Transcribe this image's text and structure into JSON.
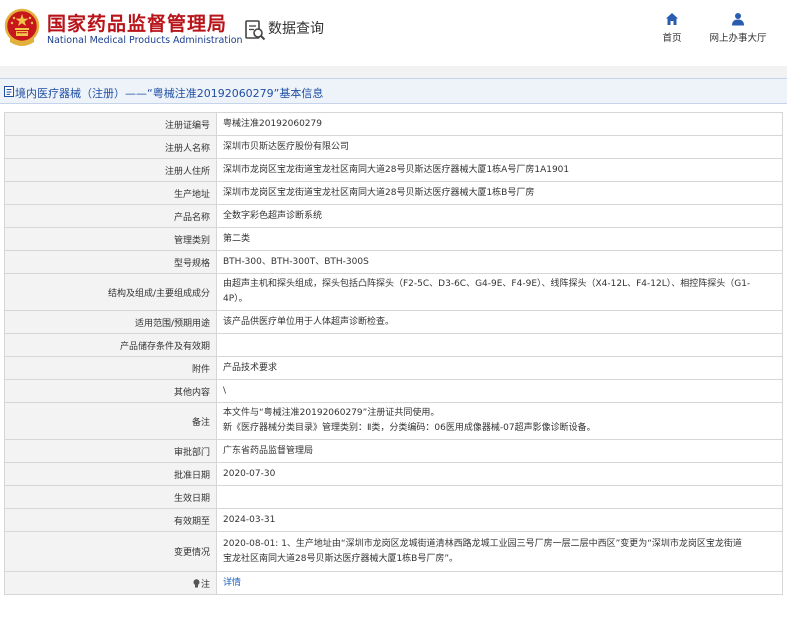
{
  "header": {
    "org_name_cn": "国家药品监督管理局",
    "org_name_en": "National Medical Products Administration",
    "section": "数据查询",
    "icons": {
      "emblem": "national-emblem-icon",
      "search": "search-document-icon",
      "home": "home-icon",
      "hall": "user-icon"
    },
    "nav": [
      {
        "label": "首页"
      },
      {
        "label": "网上办事大厅"
      }
    ]
  },
  "title_bar": {
    "text": "境内医疗器械（注册）——“粤械注准20192060279”基本信息"
  },
  "record": {
    "rows": [
      {
        "label": "注册证编号",
        "value": "粤械注准20192060279"
      },
      {
        "label": "注册人名称",
        "value": "深圳市贝斯达医疗股份有限公司"
      },
      {
        "label": "注册人住所",
        "value": "深圳市龙岗区宝龙街道宝龙社区南同大道28号贝斯达医疗器械大厦1栋A号厂房1A1901"
      },
      {
        "label": "生产地址",
        "value": "深圳市龙岗区宝龙街道宝龙社区南同大道28号贝斯达医疗器械大厦1栋B号厂房"
      },
      {
        "label": "产品名称",
        "value": "全数字彩色超声诊断系统"
      },
      {
        "label": "管理类别",
        "value": "第二类"
      },
      {
        "label": "型号规格",
        "value": "BTH-300、BTH-300T、BTH-300S"
      },
      {
        "label": "结构及组成/主要组成成分",
        "lines": [
          "由超声主机和探头组成，探头包括凸阵探头（F2-5C、D3-6C、G4-9E、F4-9E）、线阵探头（X4-12L、F4-12L）、相控阵探头（G1-",
          "4P）。"
        ]
      },
      {
        "label": "适用范围/预期用途",
        "value": "该产品供医疗单位用于人体超声诊断检查。"
      },
      {
        "label": "产品储存条件及有效期",
        "value": ""
      },
      {
        "label": "附件",
        "value": "产品技术要求"
      },
      {
        "label": "其他内容",
        "value": "\\"
      },
      {
        "label": "备注",
        "lines": [
          "本文件与“粤械注准20192060279”注册证共同使用。",
          "新《医疗器械分类目录》管理类别：Ⅱ类，分类编码：06医用成像器械-07超声影像诊断设备。"
        ]
      },
      {
        "label": "审批部门",
        "value": "广东省药品监督管理局"
      },
      {
        "label": "批准日期",
        "value": "2020-07-30"
      },
      {
        "label": "生效日期",
        "value": ""
      },
      {
        "label": "有效期至",
        "value": "2024-03-31"
      },
      {
        "label": "变更情况",
        "lines": [
          "2020-08-01: 1、生产地址由“深圳市龙岗区龙城街道清林西路龙城工业园三号厂房一层二层中西区”变更为“深圳市龙岗区宝龙街道",
          "宝龙社区南同大道28号贝斯达医疗器械大厦1栋B号厂房”。"
        ]
      },
      {
        "label": "注",
        "value": "详情",
        "link": true,
        "icon": "lightbulb-icon"
      }
    ]
  },
  "colors": {
    "brand_red": "#b8141a",
    "brand_blue": "#1a3f8f",
    "title_blue": "#1f4fa3",
    "link_blue": "#1f5fbf",
    "nav_icon_blue": "#2a5db0"
  }
}
